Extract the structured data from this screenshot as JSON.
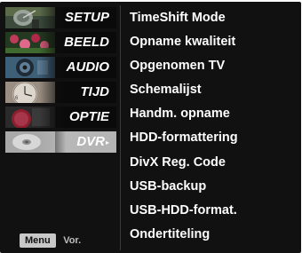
{
  "sidebar": {
    "items": [
      {
        "label": "SETUP",
        "icon": "satellite-dish-icon",
        "selected": false
      },
      {
        "label": "BEELD",
        "icon": "flowers-picture-icon",
        "selected": false
      },
      {
        "label": "AUDIO",
        "icon": "speaker-icon",
        "selected": false
      },
      {
        "label": "TIJD",
        "icon": "clock-icon",
        "selected": false
      },
      {
        "label": "OPTIE",
        "icon": "special-icon",
        "selected": false
      },
      {
        "label": "DVR",
        "icon": "disc-icon",
        "selected": true
      }
    ],
    "selected_arrow": "▸"
  },
  "options": [
    "TimeShift Mode",
    "Opname kwaliteit",
    "Opgenomen TV",
    "Schemalijst",
    "Handm. opname",
    "HDD-formattering",
    "DivX Reg. Code",
    "USB-backup",
    "USB-HDD-format.",
    "Ondertiteling"
  ],
  "footer": {
    "menu_key": "Menu",
    "label": "Vor."
  },
  "colors": {
    "background": "#111111",
    "selected_tab": "#b8b8b8",
    "text": "#ffffff"
  }
}
